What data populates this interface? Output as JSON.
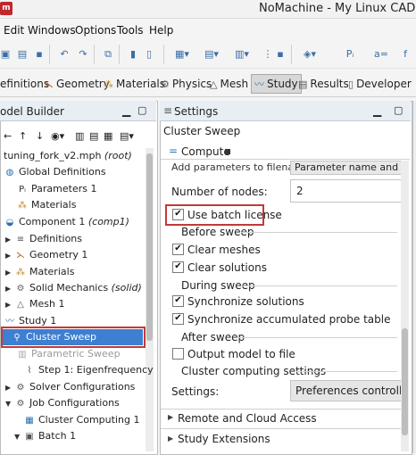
{
  "app": {
    "icon": "m",
    "title": "NoMachine - My Linux CAD V"
  },
  "menu": [
    "Edit",
    "Windows",
    "Options",
    "Tools",
    "Help"
  ],
  "ribbon": {
    "tabs": [
      {
        "label": "efinitions",
        "icon": "definitions-icon"
      },
      {
        "label": "Geometry",
        "icon": "geometry-icon"
      },
      {
        "label": "Materials",
        "icon": "materials-icon"
      },
      {
        "label": "Physics",
        "icon": "physics-icon"
      },
      {
        "label": "Mesh",
        "icon": "mesh-icon"
      },
      {
        "label": "Study",
        "icon": "study-icon"
      },
      {
        "label": "Results",
        "icon": "results-icon"
      },
      {
        "label": "Developer",
        "icon": "developer-icon"
      }
    ],
    "active": "Study"
  },
  "toolbar": {
    "p_label": "Pᵢ",
    "a_label": "a="
  },
  "model_builder": {
    "title": "odel Builder",
    "tree": [
      {
        "label": "tuning_fork_v2.mph",
        "suffix": " (root)"
      },
      {
        "label": "Global Definitions",
        "suffix": ""
      },
      {
        "label": "Parameters 1",
        "suffix": ""
      },
      {
        "label": "Materials",
        "suffix": ""
      },
      {
        "label": "Component 1",
        "suffix": " (comp1)"
      },
      {
        "label": "Definitions",
        "suffix": ""
      },
      {
        "label": "Geometry 1",
        "suffix": ""
      },
      {
        "label": "Materials",
        "suffix": ""
      },
      {
        "label": "Solid Mechanics",
        "suffix": " (solid)"
      },
      {
        "label": "Mesh 1",
        "suffix": ""
      },
      {
        "label": "Study 1",
        "suffix": ""
      },
      {
        "label": "Cluster Sweep",
        "suffix": ""
      },
      {
        "label": "Parametric Sweep",
        "suffix": ""
      },
      {
        "label": "Step 1: Eigenfrequency",
        "suffix": ""
      },
      {
        "label": "Solver Configurations",
        "suffix": ""
      },
      {
        "label": "Job Configurations",
        "suffix": ""
      },
      {
        "label": "Cluster Computing 1",
        "suffix": ""
      },
      {
        "label": "Batch 1",
        "suffix": ""
      }
    ]
  },
  "settings": {
    "title": "Settings",
    "subtitle": "Cluster Sweep",
    "compute_label": "Compute",
    "partial_label": "Add parameters to filename:",
    "partial_value": "Parameter name and valu",
    "nodes_label": "Number of nodes:",
    "nodes_value": "2",
    "batch_license_label": "Use batch license",
    "before_sweep": "Before sweep",
    "clear_meshes": "Clear meshes",
    "clear_solutions": "Clear solutions",
    "during_sweep": "During sweep",
    "sync_solutions": "Synchronize solutions",
    "sync_probe": "Synchronize accumulated probe table",
    "after_sweep": "After sweep",
    "output_model": "Output model to file",
    "cluster_settings": "Cluster computing settings",
    "settings_label": "Settings:",
    "settings_value": "Preferences controlled",
    "remote_section": "Remote and Cloud Access",
    "study_ext_section": "Study Extensions"
  },
  "checkboxes": {
    "batch_license": true,
    "clear_meshes": true,
    "clear_solutions": true,
    "sync_solutions": true,
    "sync_probe": true,
    "output_model": false
  },
  "colors": {
    "selection": "#3d7fd0",
    "highlight_box": "#c23a3a",
    "brand": "#c0282d"
  }
}
